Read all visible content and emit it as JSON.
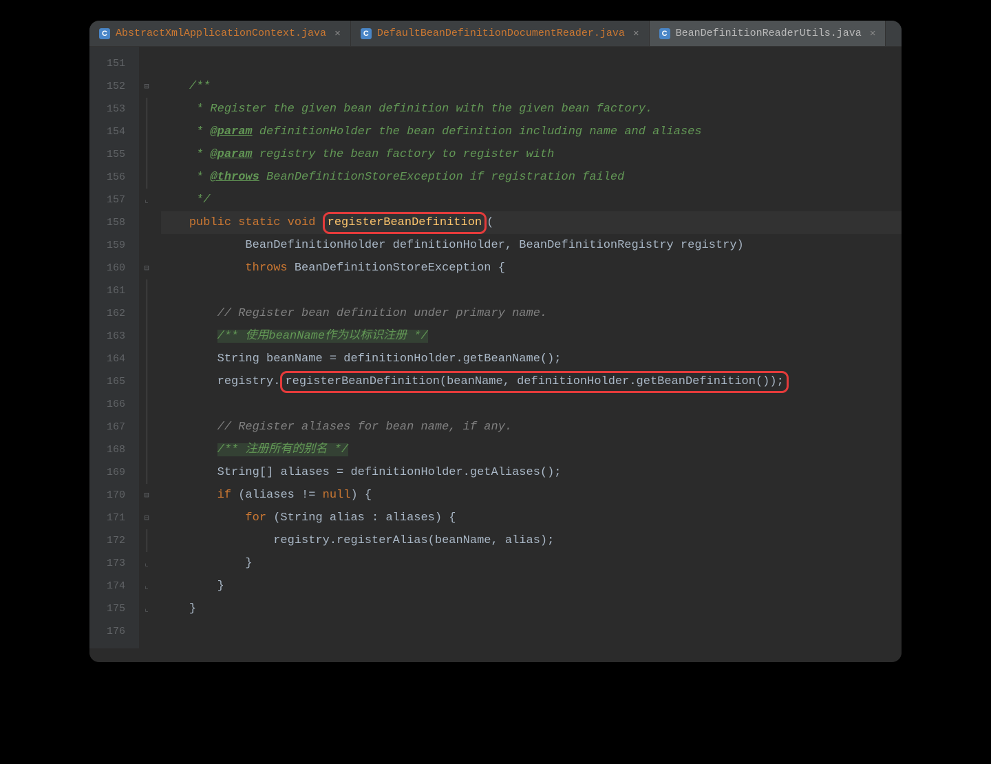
{
  "tabs": [
    {
      "name": "AbstractXmlApplicationContext.java",
      "active": false
    },
    {
      "name": "DefaultBeanDefinitionDocumentReader.java",
      "active": false
    },
    {
      "name": "BeanDefinitionReaderUtils.java",
      "active": true
    }
  ],
  "lineStart": 151,
  "code": {
    "l152": "/**",
    "l153": " * Register the given bean definition with the given bean factory.",
    "l154a": " * ",
    "l154tag": "@param",
    "l154b": " definitionHolder the bean definition including name and aliases",
    "l155a": " * ",
    "l155tag": "@param",
    "l155b": " registry the bean factory to register with",
    "l156a": " * ",
    "l156tag": "@throws",
    "l156b": " BeanDefinitionStoreException if registration failed",
    "l157": " */",
    "l158_kw": "public static void",
    "l158_method": "registerBeanDefinition",
    "l158_paren": "(",
    "l159": "BeanDefinitionHolder definitionHolder, BeanDefinitionRegistry registry)",
    "l160_kw": "throws",
    "l160_rest": " BeanDefinitionStoreException {",
    "l162": "// Register bean definition under primary name.",
    "l163a": "/** ",
    "l163b": "使用beanName作为以标识注册",
    "l163c": " */",
    "l164": "String beanName = definitionHolder.getBeanName();",
    "l165a": "registry.",
    "l165b": "registerBeanDefinition(beanName, definitionHolder.getBeanDefinition());",
    "l167": "// Register aliases for bean name, if any.",
    "l168a": "/** ",
    "l168b": "注册所有的别名",
    "l168c": " */",
    "l169": "String[] aliases = definitionHolder.getAliases();",
    "l170_if": "if",
    "l170_rest": " (aliases != ",
    "l170_null": "null",
    "l170_end": ") {",
    "l171_for": "for",
    "l171_rest": " (String alias : aliases) {",
    "l172": "registry.registerAlias(beanName, alias);",
    "l173": "}",
    "l174": "}",
    "l175": "}"
  },
  "foldMarkers": {
    "152": "open-top",
    "157": "close",
    "158": "",
    "160": "open-top",
    "170": "open-sub",
    "171": "open-sub",
    "173": "close",
    "174": "close",
    "175": "close"
  },
  "highlights": {
    "methodName": {
      "line": 158
    },
    "call": {
      "line": 165
    }
  },
  "colors": {
    "bg": "#2b2b2b",
    "gutter": "#313335",
    "keyword": "#cc7832",
    "method": "#ffc66d",
    "doc": "#629755",
    "comment": "#808080",
    "text": "#a9b7c6",
    "highlight": "#e43b3b"
  }
}
